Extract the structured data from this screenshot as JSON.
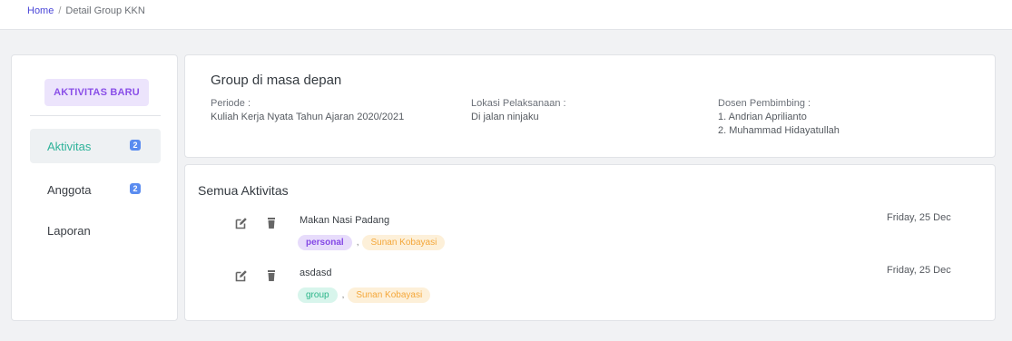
{
  "breadcrumb": {
    "home": "Home",
    "separator": "/",
    "current": "Detail Group KKN"
  },
  "sidebar": {
    "new_button": "AKTIVITAS BARU",
    "items": [
      {
        "label": "Aktivitas",
        "badge": "2",
        "active": true
      },
      {
        "label": "Anggota",
        "badge": "2",
        "active": false
      },
      {
        "label": "Laporan",
        "badge": null,
        "active": false
      }
    ]
  },
  "group": {
    "title": "Group di masa depan",
    "periode_label": "Periode :",
    "periode_value": "Kuliah Kerja Nyata Tahun Ajaran 2020/2021",
    "lokasi_label": "Lokasi Pelaksanaan :",
    "lokasi_value": "Di jalan ninjaku",
    "dosen_label": "Dosen Pembimbing :",
    "dosen": [
      "1. Andrian Aprilianto",
      "2. Muhammad Hidayatullah"
    ]
  },
  "activities": {
    "title": "Semua Aktivitas",
    "items": [
      {
        "name": "Makan Nasi Padang",
        "date": "Friday, 25 Dec",
        "type": "personal",
        "person": "Sunan Kobayasi",
        "separator": ","
      },
      {
        "name": "asdasd",
        "date": "Friday, 25 Dec",
        "type": "group",
        "person": "Sunan Kobayasi",
        "separator": ","
      }
    ]
  },
  "icons": {
    "edit": "edit-icon",
    "delete": "trash-icon"
  },
  "colors": {
    "accent_green": "#2fb39a",
    "badge_blue": "#5a8cf0",
    "personal_purple": "#8549e6",
    "person_orange": "#f4a73a",
    "link_blue": "#4a46d8"
  }
}
